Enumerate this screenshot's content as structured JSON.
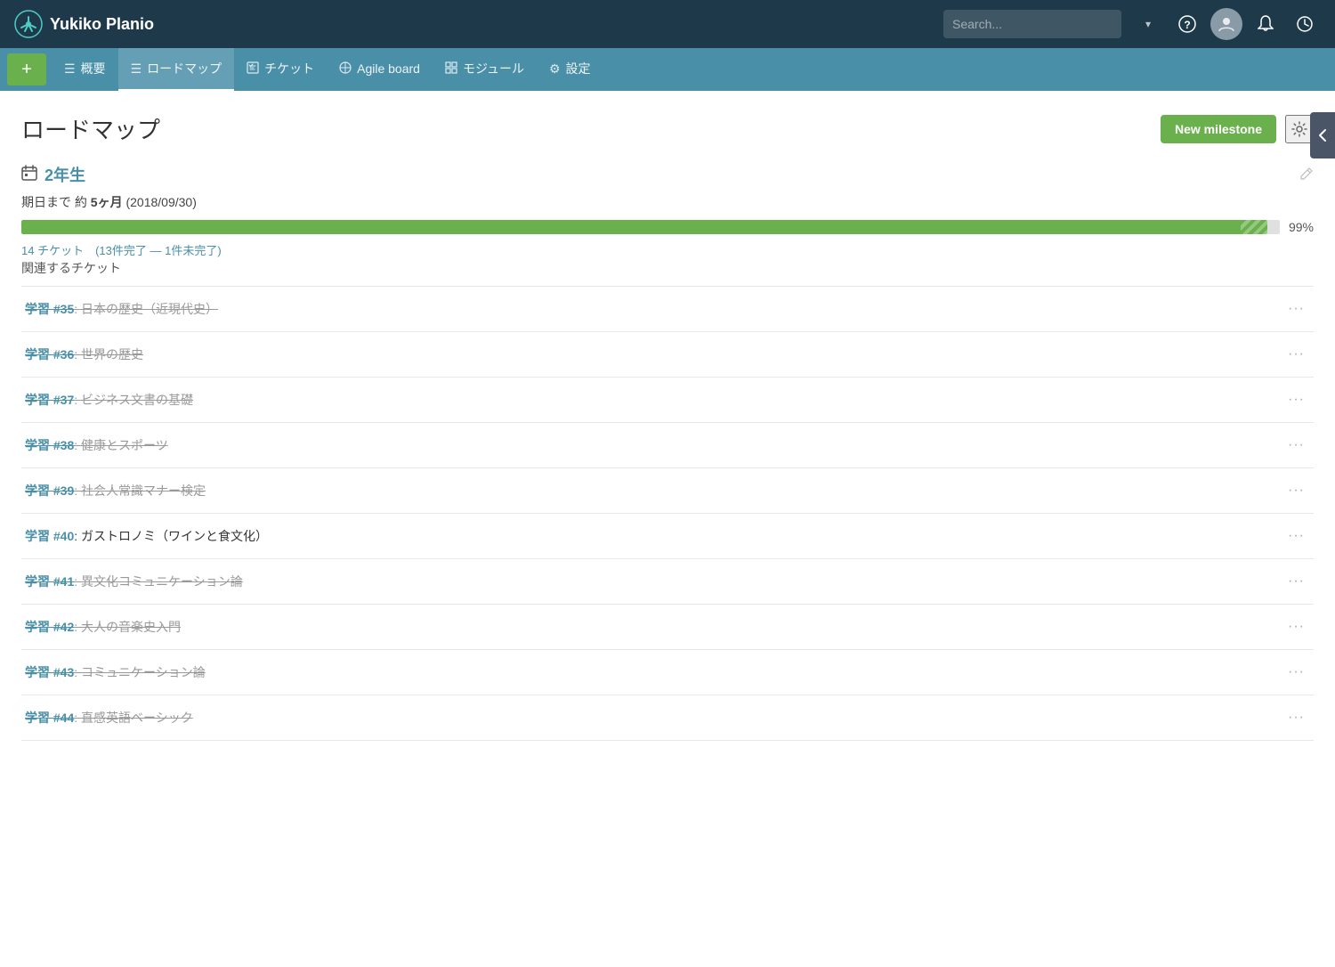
{
  "app": {
    "title": "Yukiko Planio",
    "logo_alt": "Planio logo"
  },
  "top_nav": {
    "search_placeholder": "Search...",
    "dropdown_label": "▾",
    "help_label": "?",
    "notification_label": "🔔",
    "clock_label": "⊙"
  },
  "sub_nav": {
    "add_label": "+",
    "items": [
      {
        "id": "overview",
        "label": "概要",
        "icon": "☰"
      },
      {
        "id": "roadmap",
        "label": "ロードマップ",
        "icon": "☰",
        "active": true
      },
      {
        "id": "tickets",
        "label": "チケット",
        "icon": "✓"
      },
      {
        "id": "agile",
        "label": "Agile board",
        "icon": "⊞"
      },
      {
        "id": "modules",
        "label": "モジュール",
        "icon": "⊞"
      },
      {
        "id": "settings",
        "label": "設定",
        "icon": "⚙"
      }
    ]
  },
  "page": {
    "title": "ロードマップ",
    "new_milestone_label": "New milestone",
    "settings_icon": "⚙",
    "side_toggle_icon": "❯"
  },
  "milestone": {
    "name": "2年生",
    "due_text": "期日まで 約",
    "due_bold": "5ヶ月",
    "due_date": "(2018/09/30)",
    "progress_percent": 99,
    "progress_bar_width": "99%",
    "ticket_summary": "14 チケット　(13件完了 — 1件未完了)",
    "related_label": "関連するチケット",
    "tickets": [
      {
        "id": "#35",
        "prefix": "学習",
        "title": "日本の歴史（近現代史）",
        "completed": true
      },
      {
        "id": "#36",
        "prefix": "学習",
        "title": "世界の歴史",
        "completed": true
      },
      {
        "id": "#37",
        "prefix": "学習",
        "title": "ビジネス文書の基礎",
        "completed": true
      },
      {
        "id": "#38",
        "prefix": "学習",
        "title": "健康とスポーツ",
        "completed": true
      },
      {
        "id": "#39",
        "prefix": "学習",
        "title": "社会人常識マナー検定",
        "completed": true
      },
      {
        "id": "#40",
        "prefix": "学習",
        "title": "ガストロノミ（ワインと食文化）",
        "completed": false
      },
      {
        "id": "#41",
        "prefix": "学習",
        "title": "異文化コミュニケーション論",
        "completed": true
      },
      {
        "id": "#42",
        "prefix": "学習",
        "title": "大人の音楽史入門",
        "completed": true
      },
      {
        "id": "#43",
        "prefix": "学習",
        "title": "コミュニケーション論",
        "completed": true
      },
      {
        "id": "#44",
        "prefix": "学習",
        "title": "直感英語ベーシック",
        "completed": true
      }
    ]
  }
}
